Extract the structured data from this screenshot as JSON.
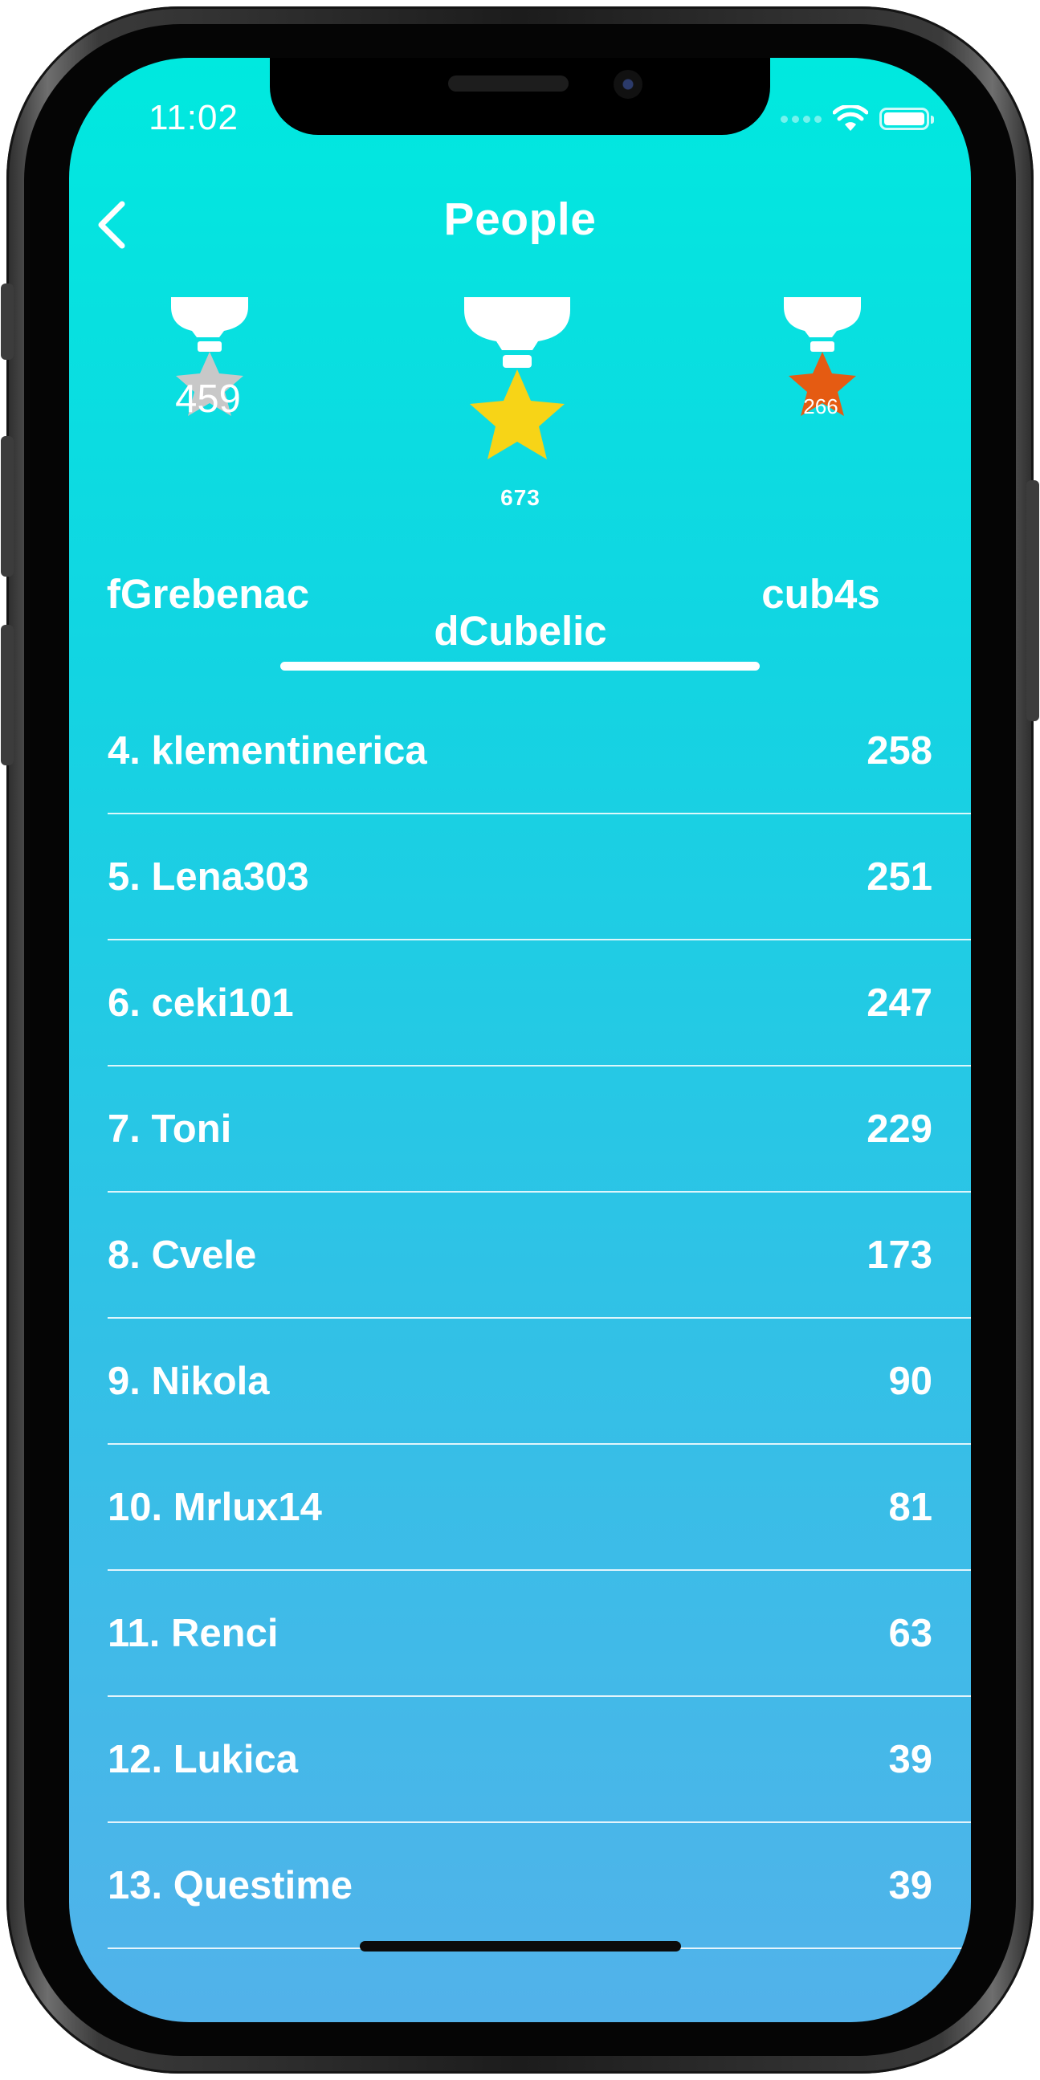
{
  "status_bar": {
    "time": "11:02"
  },
  "header": {
    "title": "People"
  },
  "podium": [
    {
      "place": 2,
      "name": "fGrebenac",
      "score": "459",
      "medal_color": "#c8c8c8"
    },
    {
      "place": 1,
      "name": "dCubelic",
      "score": "673",
      "medal_color": "#f7d417"
    },
    {
      "place": 3,
      "name": "cub4s",
      "score": "266",
      "medal_color": "#e55b12"
    }
  ],
  "leaderboard": [
    {
      "label": "4. klementinerica",
      "score": "258"
    },
    {
      "label": "5. Lena303",
      "score": "251"
    },
    {
      "label": "6. ceki101",
      "score": "247"
    },
    {
      "label": "7. Toni",
      "score": "229"
    },
    {
      "label": "8. Cvele",
      "score": "173"
    },
    {
      "label": "9. Nikola",
      "score": "90"
    },
    {
      "label": "10. Mrlux14",
      "score": "81"
    },
    {
      "label": "11. Renci",
      "score": "63"
    },
    {
      "label": "12. Lukica",
      "score": "39"
    },
    {
      "label": "13. Questime",
      "score": "39"
    }
  ],
  "colors": {
    "background_top": "#00e9df",
    "background_bottom": "#52b2ea",
    "silver": "#c8c8c8",
    "gold": "#f7d417",
    "bronze": "#e55b12"
  },
  "icons": {
    "back": "chevron-left-icon",
    "medal": "star-medal-icon",
    "wifi": "wifi-icon",
    "battery": "battery-icon"
  }
}
